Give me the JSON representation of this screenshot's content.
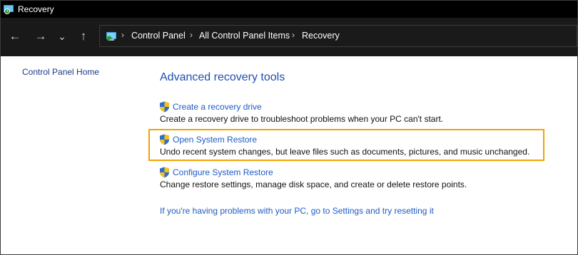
{
  "window": {
    "title": "Recovery"
  },
  "nav": {
    "back": "←",
    "forward": "→",
    "recent": "⌄",
    "up": "↑"
  },
  "breadcrumb": [
    "Control Panel",
    "All Control Panel Items",
    "Recovery"
  ],
  "sidebar": {
    "home_link": "Control Panel Home"
  },
  "main": {
    "heading": "Advanced recovery tools",
    "tasks": [
      {
        "link": "Create a recovery drive",
        "desc": "Create a recovery drive to troubleshoot problems when your PC can't start."
      },
      {
        "link": "Open System Restore",
        "desc": "Undo recent system changes, but leave files such as documents, pictures, and music unchanged."
      },
      {
        "link": "Configure System Restore",
        "desc": "Change restore settings, manage disk space, and create or delete restore points."
      }
    ],
    "reset_link": "If you're having problems with your PC, go to Settings and try resetting it"
  },
  "colors": {
    "highlight": "#f2a300",
    "link": "#1d5cc5",
    "heading": "#1e4fb0"
  },
  "icons": {
    "app": "recovery-icon",
    "address": "control-panel-icon",
    "task": "uac-shield-icon"
  }
}
